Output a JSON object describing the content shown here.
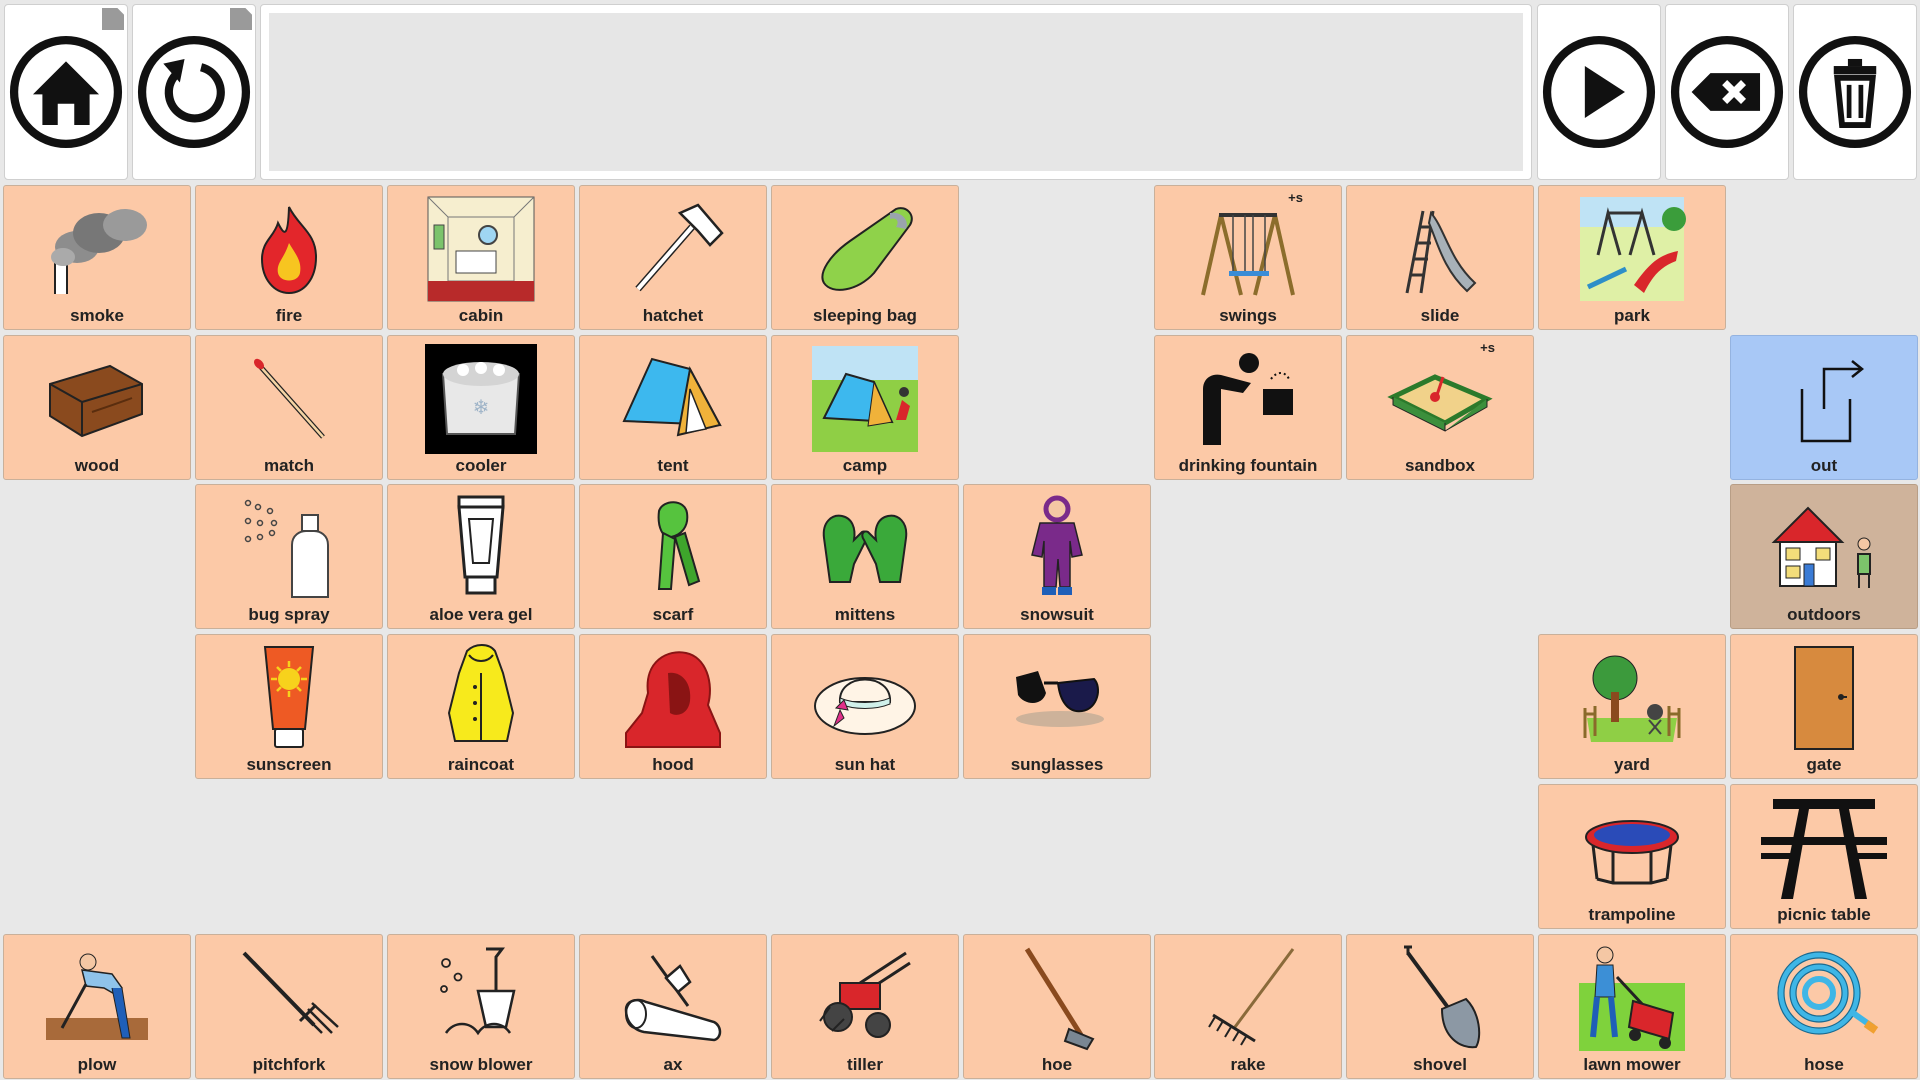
{
  "toolbar": {
    "home": "home-icon",
    "back": "undo-icon",
    "speak": "play-icon",
    "backspace": "backspace-icon",
    "clear": "trash-icon"
  },
  "cells": {
    "smoke": "smoke",
    "fire": "fire",
    "cabin": "cabin",
    "hatchet": "hatchet",
    "sleeping_bag": "sleeping bag",
    "swings": "swings",
    "slide": "slide",
    "park": "park",
    "wood": "wood",
    "match": "match",
    "cooler": "cooler",
    "tent": "tent",
    "camp": "camp",
    "drinking_fountain": "drinking fountain",
    "sandbox": "sandbox",
    "out": "out",
    "bug_spray": "bug spray",
    "aloe_vera_gel": "aloe vera gel",
    "scarf": "scarf",
    "mittens": "mittens",
    "snowsuit": "snowsuit",
    "outdoors": "outdoors",
    "sunscreen": "sunscreen",
    "raincoat": "raincoat",
    "hood": "hood",
    "sun_hat": "sun hat",
    "sunglasses": "sunglasses",
    "yard": "yard",
    "gate": "gate",
    "trampoline": "trampoline",
    "picnic_table": "picnic table",
    "plow": "plow",
    "pitchfork": "pitchfork",
    "snow_blower": "snow blower",
    "ax": "ax",
    "tiller": "tiller",
    "hoe": "hoe",
    "rake": "rake",
    "shovel": "shovel",
    "lawn_mower": "lawn mower",
    "hose": "hose"
  },
  "plural_badge": "+s",
  "colors": {
    "cell": "#fcc9a7",
    "out_cell": "#a8c8f6",
    "outdoors_cell": "#cfb39b",
    "background": "#e8e8e8"
  }
}
